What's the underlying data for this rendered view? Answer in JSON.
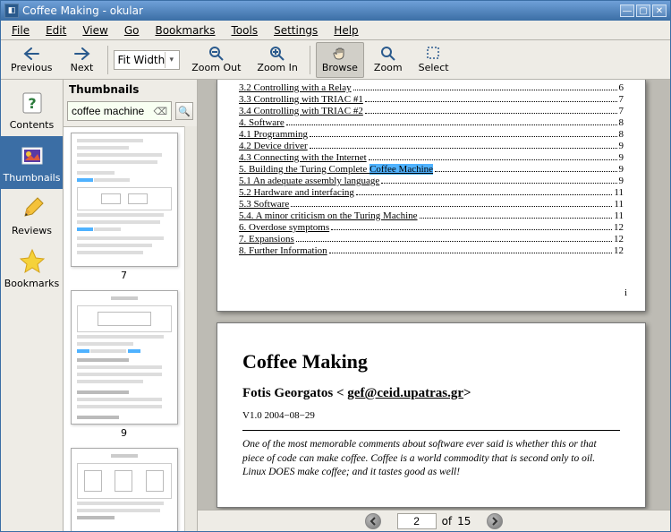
{
  "window": {
    "title": "Coffee Making - okular"
  },
  "menu": {
    "file": "File",
    "edit": "Edit",
    "view": "View",
    "go": "Go",
    "bookmarks": "Bookmarks",
    "tools": "Tools",
    "settings": "Settings",
    "help": "Help"
  },
  "toolbar": {
    "previous": "Previous",
    "next": "Next",
    "zoom_mode": "Fit Width",
    "zoom_out": "Zoom Out",
    "zoom_in": "Zoom In",
    "browse": "Browse",
    "zoom": "Zoom",
    "select": "Select"
  },
  "sidebar": {
    "tabs": {
      "contents": "Contents",
      "thumbnails": "Thumbnails",
      "reviews": "Reviews",
      "bookmarks": "Bookmarks"
    },
    "active": "thumbnails"
  },
  "thumbnails": {
    "header": "Thumbnails",
    "search_value": "coffee machine",
    "items": [
      {
        "num": "7"
      },
      {
        "num": "9"
      }
    ]
  },
  "document": {
    "toc": [
      {
        "label": "3.2 Controlling with a Relay",
        "page": "6"
      },
      {
        "label": "3.3 Controlling with TRIAC #1",
        "page": "7"
      },
      {
        "label": "3.4 Controlling with TRIAC #2",
        "page": "7"
      },
      {
        "label": "4. Software",
        "page": "8"
      },
      {
        "label": "4.1 Programming",
        "page": "8"
      },
      {
        "label": "4.2 Device driver",
        "page": "9"
      },
      {
        "label": "4.3 Connecting with the Internet",
        "page": "9"
      },
      {
        "label_pre": "5. Building the Turing Complete ",
        "hit": "Coffee Machine",
        "page": "9"
      },
      {
        "label": "5.1 An adequate assembly language",
        "page": "9"
      },
      {
        "label": "5.2 Hardware and interfacing",
        "page": "11"
      },
      {
        "label": "5.3 Software",
        "page": "11"
      },
      {
        "label": "5.4. A minor criticism on the Turing Machine",
        "page": "11"
      },
      {
        "label": "6. Overdose symptoms",
        "page": "12"
      },
      {
        "label": "7. Expansions",
        "page": "12"
      },
      {
        "label": "8. Further Information",
        "page": "12"
      }
    ],
    "cover": {
      "title": "Coffee Making",
      "author_pre": "Fotis Georgatos < ",
      "author_email": "gef@ceid.upatras.gr",
      "author_post": ">",
      "version": "V1.0  2004−08−29",
      "blurb": "One of the most memorable comments about software ever said is whether this or that piece of code can make coffee. Coffee is a world commodity that is second only to oil. Linux DOES make coffee; and it tastes good as well!"
    }
  },
  "pagenav": {
    "current": "2",
    "of_label": "of",
    "total": "15"
  }
}
